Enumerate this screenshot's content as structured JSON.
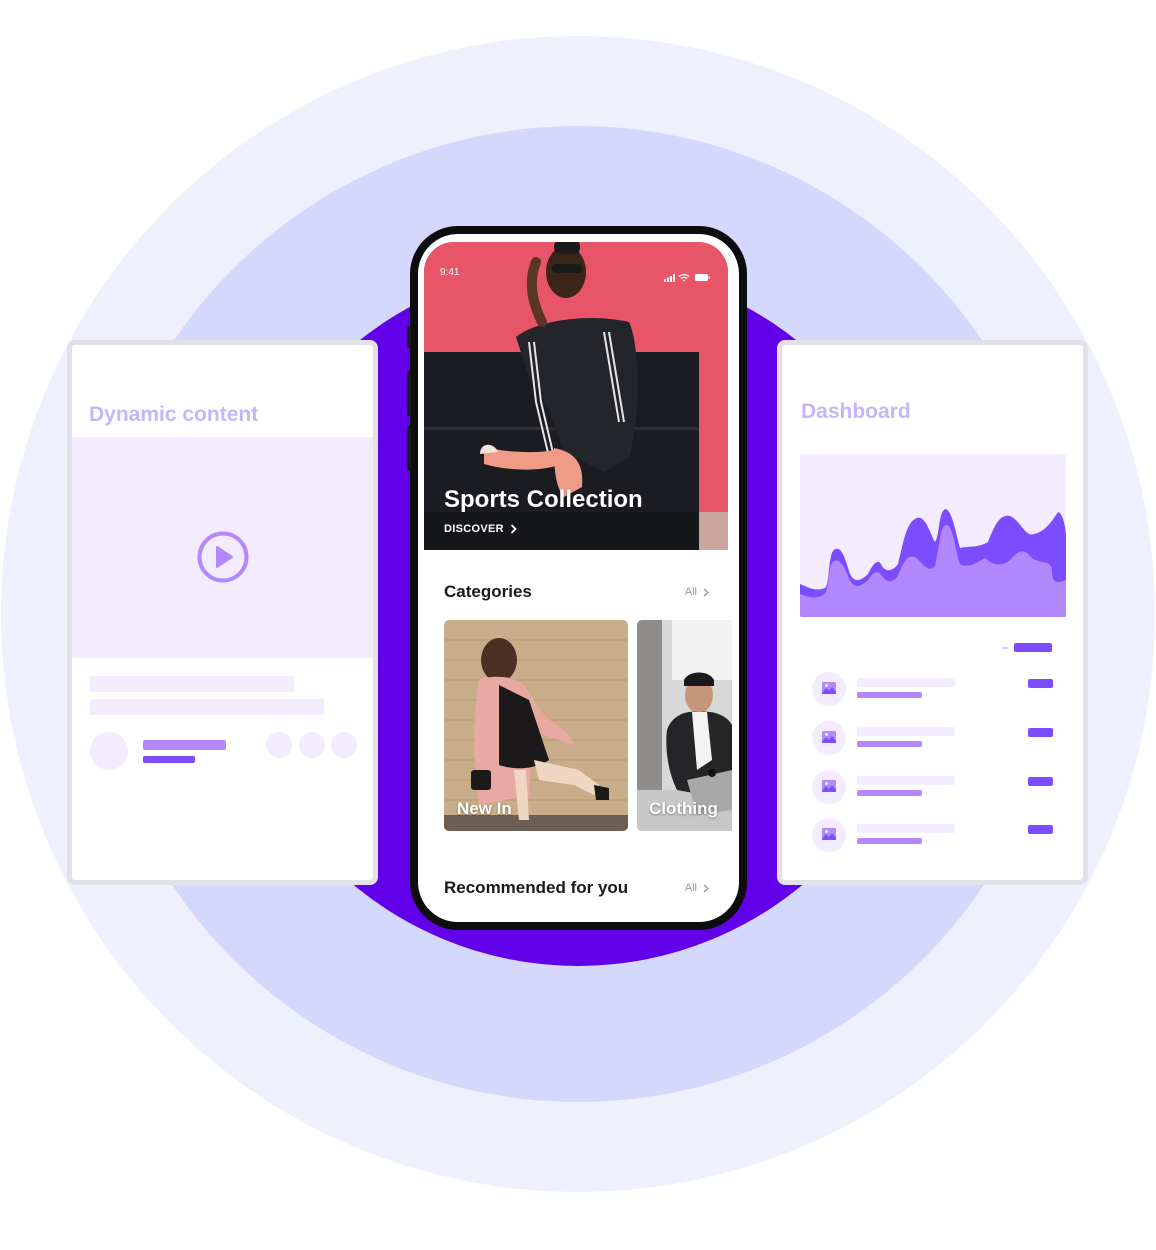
{
  "left_card": {
    "title": "Dynamic content",
    "media_icon": "play-circle-icon"
  },
  "right_card": {
    "title": "Dashboard",
    "chart_icon": "area-chart",
    "list_items": [
      {
        "icon": "image-icon"
      },
      {
        "icon": "image-icon"
      },
      {
        "icon": "image-icon"
      },
      {
        "icon": "image-icon"
      }
    ]
  },
  "phone": {
    "status_bar": {
      "time": "9:41",
      "icons": [
        "signal-icon",
        "wifi-icon",
        "battery-icon"
      ]
    },
    "hero": {
      "title": "Sports Collection",
      "cta_label": "DISCOVER",
      "cta_icon": "chevron-right-icon"
    },
    "categories": {
      "title": "Categories",
      "all_label": "All",
      "items": [
        {
          "label": "New In"
        },
        {
          "label": "Clothing"
        }
      ]
    },
    "recommended": {
      "title": "Recommended for you",
      "all_label": "All"
    }
  },
  "colors": {
    "accent": "#6200ea",
    "purple_medium": "#7c4dff",
    "purple_light": "#b388ff",
    "lavender": "#f3ebfe",
    "title_text": "#c6b5fb"
  }
}
